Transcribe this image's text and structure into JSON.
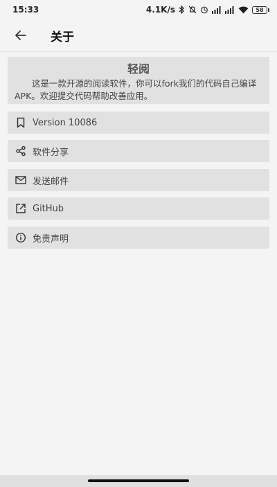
{
  "status_bar": {
    "time": "15:33",
    "network_speed": "4.1K/s",
    "battery": "58",
    "icons": [
      "bluetooth-icon",
      "mute-icon",
      "alarm-icon",
      "signal-icon",
      "signal-icon",
      "wifi-icon",
      "battery-icon"
    ]
  },
  "app_bar": {
    "back_icon": "arrow-left-icon",
    "title": "关于"
  },
  "header": {
    "app_name": "轻阅",
    "description": "这是一款开源的阅读软件，你可以fork我们的代码自己编译APK。欢迎提交代码帮助改善应用。"
  },
  "menu": [
    {
      "icon": "bookmark-icon",
      "label": "Version 10086"
    },
    {
      "icon": "share-icon",
      "label": "软件分享"
    },
    {
      "icon": "mail-icon",
      "label": "发送邮件"
    },
    {
      "icon": "external-link-icon",
      "label": "GitHub"
    },
    {
      "icon": "info-icon",
      "label": "免责声明"
    }
  ]
}
